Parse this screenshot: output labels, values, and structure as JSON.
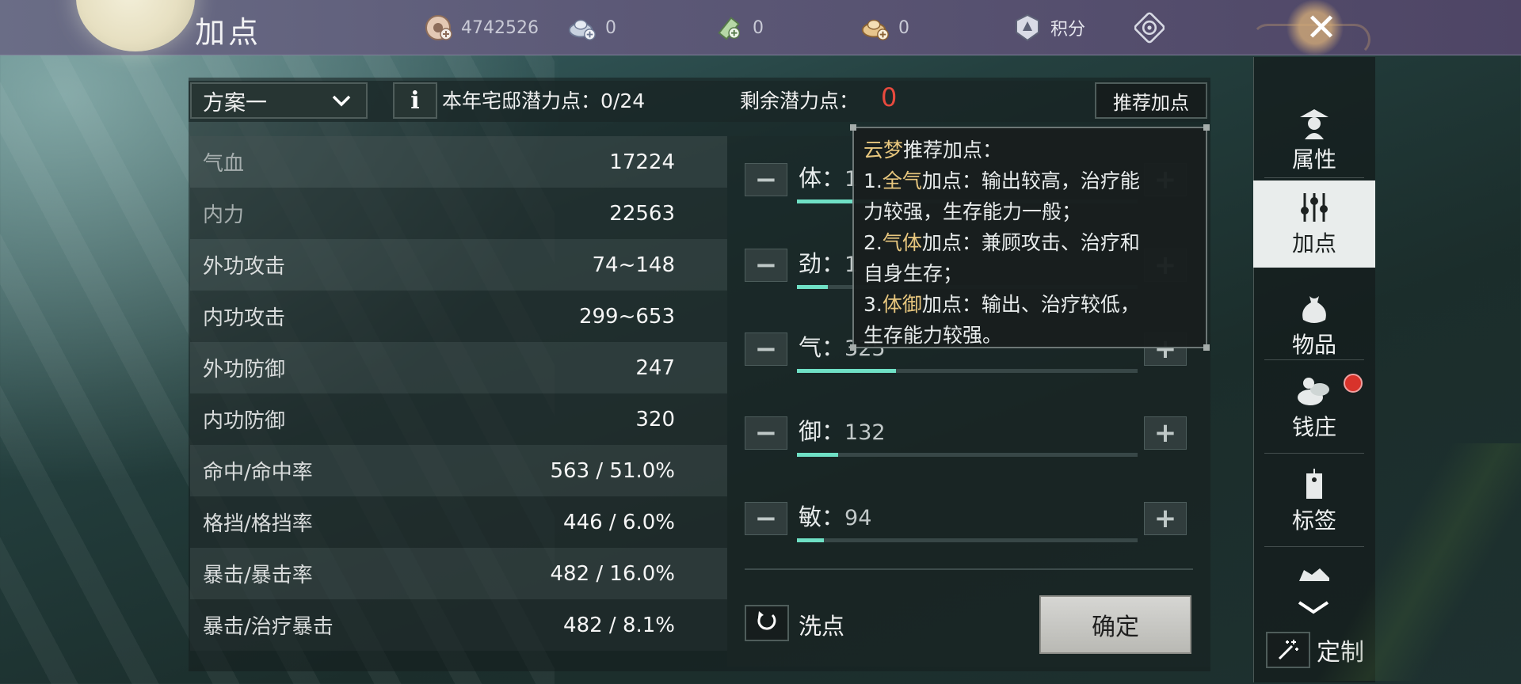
{
  "header": {
    "title": "加点",
    "currencies": [
      {
        "icon": "silver-coin-icon",
        "value": "4742526"
      },
      {
        "icon": "silver-ingot-add-icon",
        "value": "0"
      },
      {
        "icon": "green-ticket-add-icon",
        "value": "0"
      },
      {
        "icon": "gold-ingot-add-icon",
        "value": "0"
      }
    ],
    "score_label": "积分",
    "close_icon": "✕"
  },
  "toolbar": {
    "plan_selected": "方案一",
    "info_label": "i",
    "house_potential_label": "本年宅邸潜力点：0/24",
    "remaining_label": "剩余潜力点：",
    "remaining_value": "0",
    "recommend_label": "推荐加点"
  },
  "stats": [
    {
      "label": "气血",
      "value": "17224",
      "dim": true
    },
    {
      "label": "内力",
      "value": "22563",
      "dim": true
    },
    {
      "label": "外功攻击",
      "value": "74~148",
      "dim": false
    },
    {
      "label": "内功攻击",
      "value": "299~653",
      "dim": false
    },
    {
      "label": "外功防御",
      "value": "247",
      "dim": false
    },
    {
      "label": "内功防御",
      "value": "320",
      "dim": false
    },
    {
      "label": "命中/命中率",
      "value": "563 / 51.0%",
      "dim": false
    },
    {
      "label": "格挡/格挡率",
      "value": "446 / 6.0%",
      "dim": false
    },
    {
      "label": "暴击/暴击率",
      "value": "482 / 16.0%",
      "dim": false
    },
    {
      "label": "暴击/治疗暴击",
      "value": "482 / 8.1%",
      "dim": false
    }
  ],
  "attributes": [
    {
      "name": "体",
      "value": "1",
      "fill": 0.28
    },
    {
      "name": "劲",
      "value": "1",
      "fill": 0.09
    },
    {
      "name": "气",
      "value": "325",
      "fill": 0.29
    },
    {
      "name": "御",
      "value": "132",
      "fill": 0.12
    },
    {
      "name": "敏",
      "value": "94",
      "fill": 0.08
    }
  ],
  "tooltip": {
    "line1_hl": "云梦",
    "line1_rest": "推荐加点：",
    "line2_pre": "1.",
    "line2_hl": "全气",
    "line2_rest": "加点：输出较高，治疗能",
    "line3": "力较强，生存能力一般；",
    "line4_pre": "2.",
    "line4_hl": "气体",
    "line4_rest": "加点：兼顾攻击、治疗和",
    "line5": "自身生存；",
    "line6_pre": "3.",
    "line6_hl": "体御",
    "line6_rest": "加点：输出、治疗较低，",
    "line7": "生存能力较强。"
  },
  "actions": {
    "reset_label": "洗点",
    "confirm_label": "确定"
  },
  "sidenav": {
    "items": [
      {
        "label": "属性",
        "icon": "attribute-icon"
      },
      {
        "label": "加点",
        "icon": "sliders-icon"
      },
      {
        "label": "物品",
        "icon": "bag-icon"
      },
      {
        "label": "钱庄",
        "icon": "bank-icon"
      },
      {
        "label": "标签",
        "icon": "tag-icon"
      }
    ],
    "custom_label": "定制"
  },
  "colors": {
    "accent_fill": "#6fe0c5",
    "remaining_red": "#e84a3e",
    "highlight_gold": "#e8c77e",
    "active_tab_bg": "#e9edec"
  }
}
